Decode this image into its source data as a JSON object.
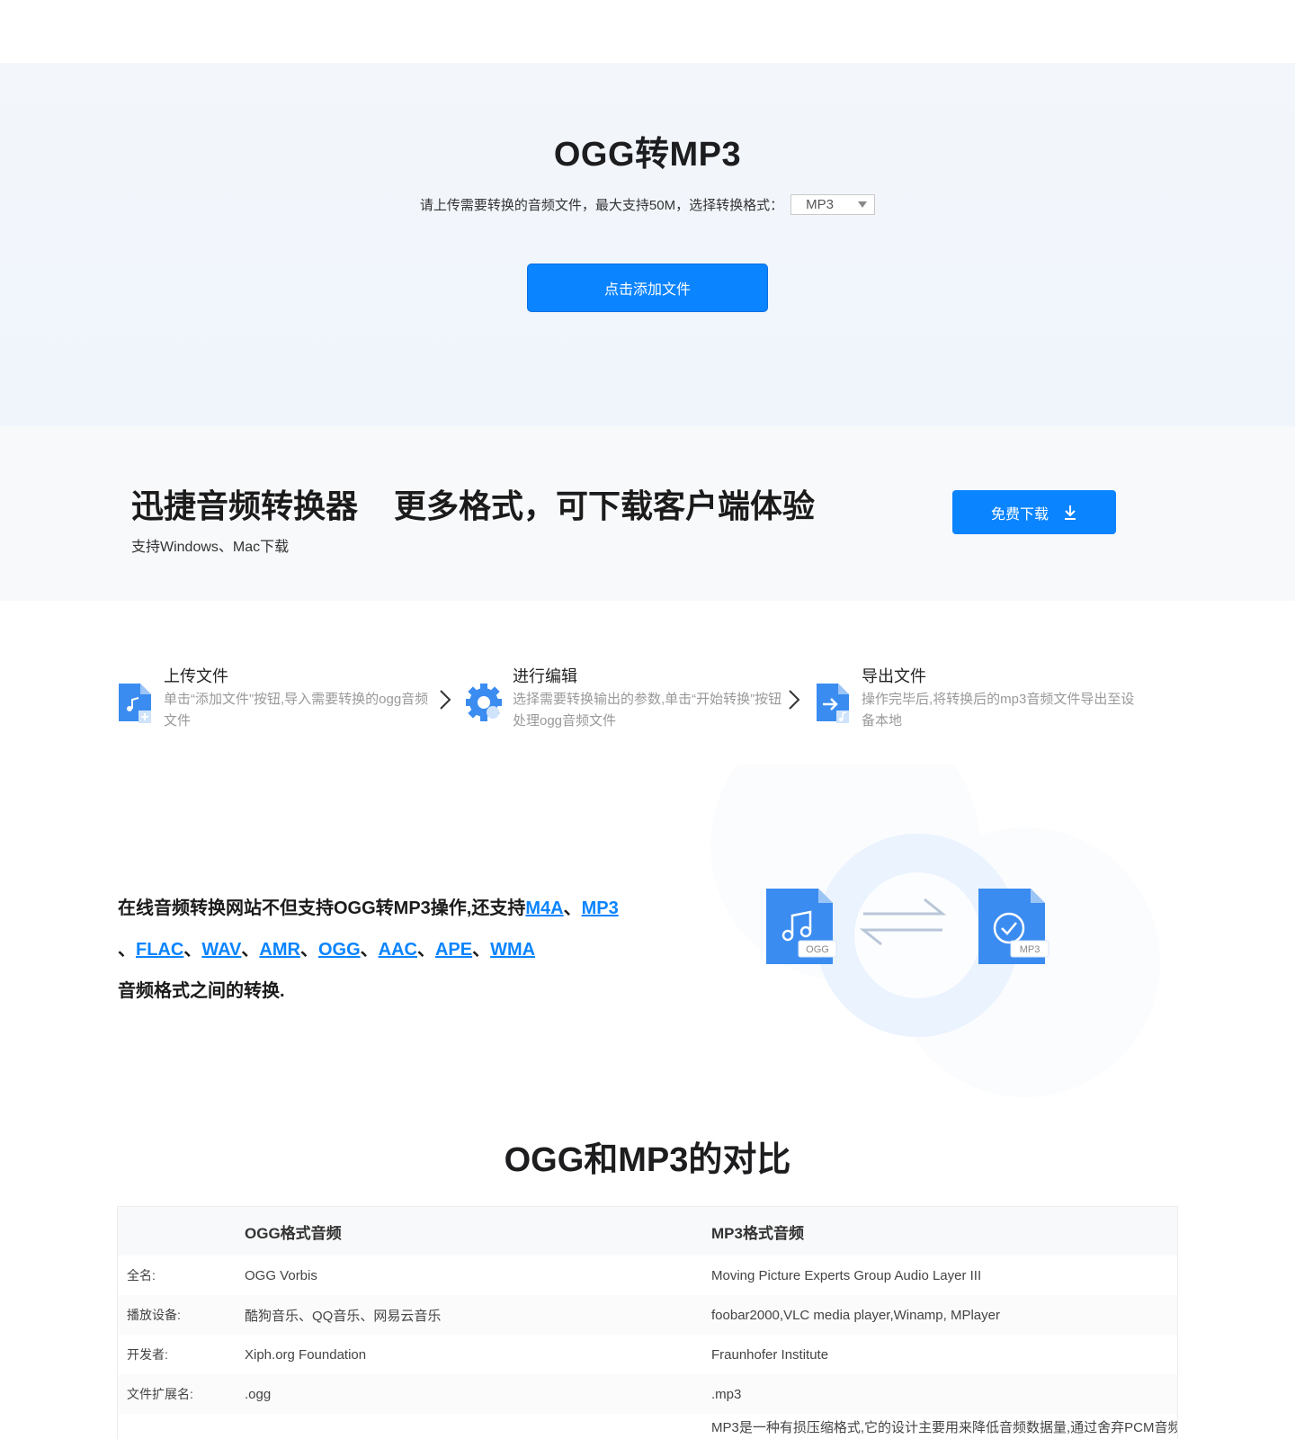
{
  "hero": {
    "title": "OGG转MP3",
    "subtitle": "请上传需要转换的音频文件，最大支持50M，选择转换格式：",
    "format_selected": "MP3",
    "upload_button": "点击添加文件"
  },
  "promo": {
    "title_a": "迅捷音频转换器",
    "title_b": "更多格式，可下载客户端体验",
    "subtitle": "支持Windows、Mac下载",
    "download_button": "免费下载"
  },
  "steps": [
    {
      "title": "上传文件",
      "desc": "单击“添加文件”按钮,导入需要转换的ogg音频文件"
    },
    {
      "title": "进行编辑",
      "desc": "选择需要转换输出的参数,单击“开始转换”按钮处理ogg音频文件"
    },
    {
      "title": "导出文件",
      "desc": "操作完毕后,将转换后的mp3音频文件导出至设备本地"
    }
  ],
  "feature": {
    "lead": "在线音频转换网站不但支持OGG转MP3操作,还支持",
    "links": [
      "M4A",
      "MP3",
      "FLAC",
      "WAV",
      "AMR",
      "OGG",
      "AAC",
      "APE",
      "WMA"
    ],
    "sep": "、",
    "tail": "音频格式之间的转换.",
    "badge_left": "OGG",
    "badge_right": "MP3"
  },
  "comparison": {
    "title": "OGG和MP3的对比",
    "headers": [
      "",
      "OGG格式音频",
      "MP3格式音频"
    ],
    "rows": [
      [
        "全名:",
        "OGG Vorbis",
        "Moving Picture Experts Group Audio Layer III"
      ],
      [
        "播放设备:",
        "酷狗音乐、QQ音乐、网易云音乐",
        "foobar2000,VLC media player,Winamp, MPlayer"
      ],
      [
        "开发者:",
        "Xiph.org Foundation",
        "Fraunhofer Institute"
      ],
      [
        "文件扩展名:",
        ".ogg",
        ".mp3"
      ],
      [
        "",
        "",
        "MP3是一种有损压缩格式,它的设计主要用来降低音频数据量,通过舍弃PCM音频"
      ]
    ]
  },
  "colors": {
    "accent": "#0a84ff",
    "hero_bg": "#f1f5fb",
    "icon_blue": "#3b8cf0"
  }
}
